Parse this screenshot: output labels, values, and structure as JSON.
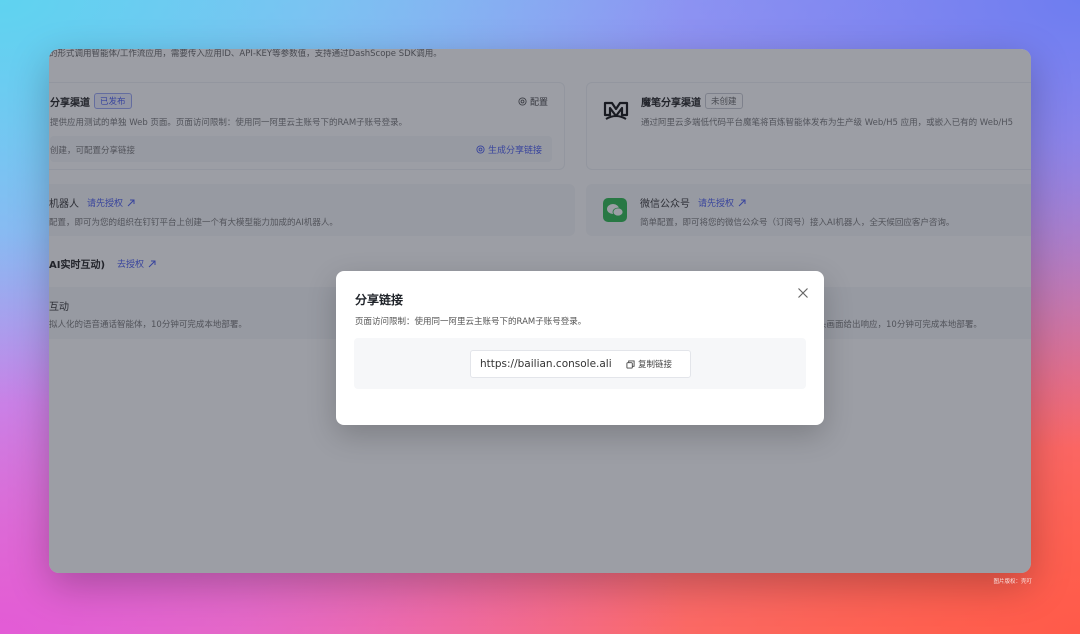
{
  "background": {
    "intro_text": "的形式调用智能体/工作流应用，需要传入应用ID、API-KEY等参数值，支持通过DashScope SDK调用。",
    "web_channel": {
      "title": "分享渠道",
      "badge": "已发布",
      "config_label": "配置",
      "description": "提供应用测试的单独 Web 页面。页面访问限制：使用同一阿里云主账号下的RAM子账号登录。",
      "status_text": "创建，可配置分享链接",
      "generate_link_label": "生成分享链接"
    },
    "mobi_channel": {
      "title": "魔笔分享渠道",
      "badge": "未创建",
      "description": "通过阿里云多端低代码平台魔笔将百炼智能体发布为生产级 Web/H5 应用，或嵌入已有的 Web/H5"
    },
    "dingtalk_card": {
      "title": "机器人",
      "auth_label": "请先授权",
      "description": "配置，即可为您的组织在钉钉平台上创建一个有大模型能力加成的AI机器人。"
    },
    "wechat_card": {
      "title": "微信公众号",
      "auth_label": "请先授权",
      "description": "简单配置，即可将您的微信公众号（订阅号）接入AI机器人，全天候回应客户咨询。"
    },
    "section_realtime": {
      "heading": "AI实时互动)",
      "auth_label": "去授权"
    },
    "voice_card": {
      "title": "互动",
      "description": "拟人化的语音通话智能体，10分钟可完成本地部署。"
    },
    "video_card": {
      "description": "头画面给出响应，10分钟可完成本地部署。"
    }
  },
  "modal": {
    "title": "分享链接",
    "description": "页面访问限制：使用同一阿里云主账号下的RAM子账号登录。",
    "url": "https://bailian.console.ali...",
    "copy_label": "复制链接"
  },
  "watermark": "图片版权：壳叮",
  "icons": {
    "close": "close-icon",
    "copy": "copy-icon",
    "settings": "settings-icon",
    "generate": "link-icon",
    "external": "arrow-up-right-icon",
    "mobi_logo": "mobi-logo-icon",
    "wechat_logo": "wechat-icon"
  },
  "colors": {
    "accent": "#4a5cf0",
    "wechat_green": "#2dbb4f",
    "overlay": "rgba(35,40,55,0.45)"
  }
}
